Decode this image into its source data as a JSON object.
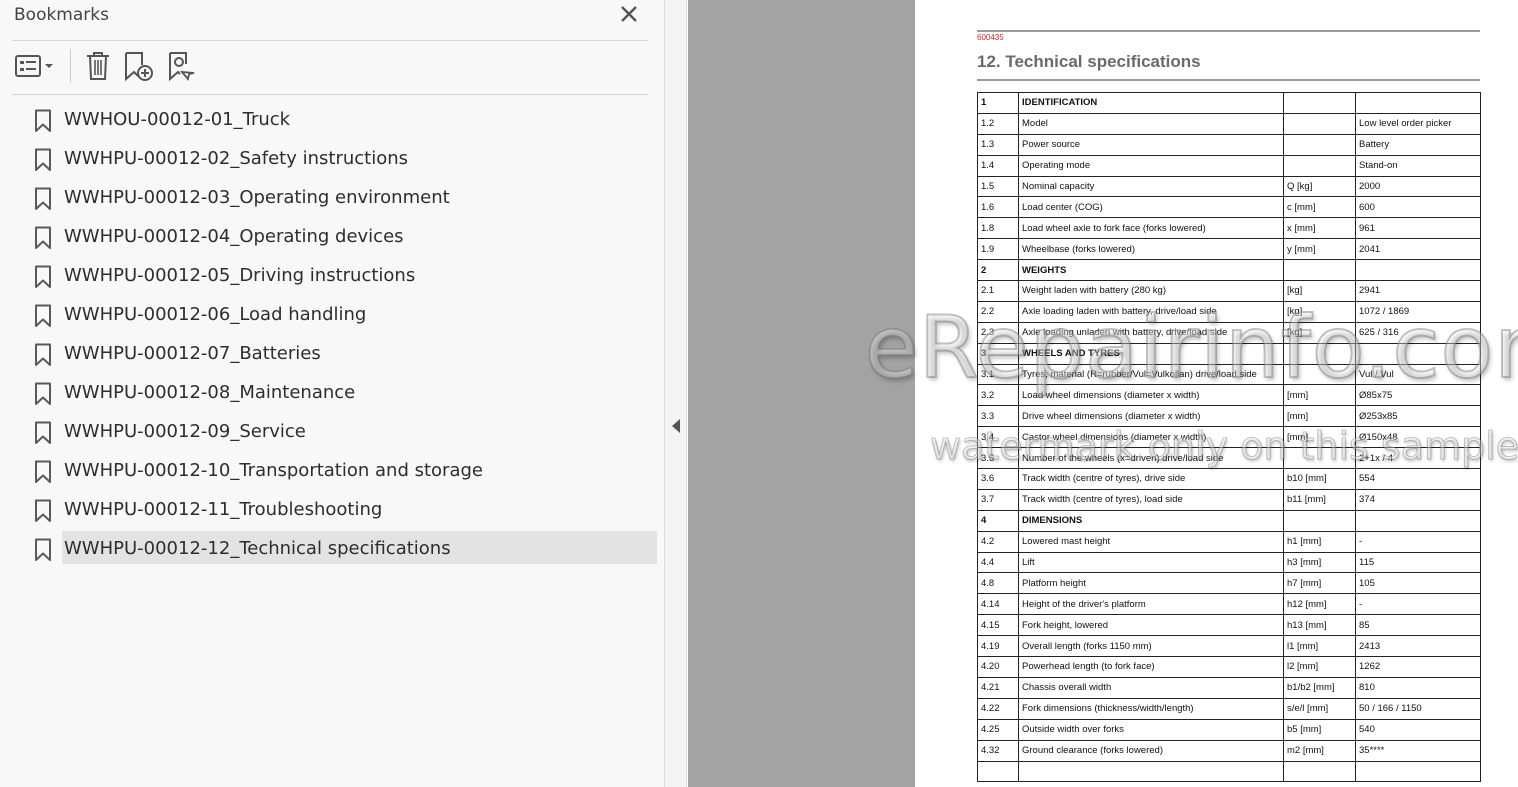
{
  "panel": {
    "title": "Bookmarks",
    "toolbar": {
      "options_icon": "list-options-icon",
      "delete_icon": "trash-icon",
      "add_icon": "add-bookmark-icon",
      "find_icon": "find-bookmark-icon"
    },
    "bookmarks": [
      {
        "label": "WWHOU-00012-01_Truck"
      },
      {
        "label": "WWHPU-00012-02_Safety instructions"
      },
      {
        "label": "WWHPU-00012-03_Operating environment"
      },
      {
        "label": "WWHPU-00012-04_Operating devices"
      },
      {
        "label": "WWHPU-00012-05_Driving instructions"
      },
      {
        "label": "WWHPU-00012-06_Load handling"
      },
      {
        "label": "WWHPU-00012-07_Batteries"
      },
      {
        "label": "WWHPU-00012-08_Maintenance"
      },
      {
        "label": "WWHPU-00012-09_Service"
      },
      {
        "label": "WWHPU-00012-10_Transportation and storage"
      },
      {
        "label": "WWHPU-00012-11_Troubleshooting"
      },
      {
        "label": "WWHPU-00012-12_Technical specifications",
        "selected": true
      }
    ]
  },
  "document": {
    "code": "600435",
    "heading": "12. Technical specifications",
    "rows": [
      {
        "no": "1",
        "desc": "IDENTIFICATION",
        "unit": "",
        "value": "",
        "section": true
      },
      {
        "no": "1.2",
        "desc": "Model",
        "unit": "",
        "value": "Low level order picker"
      },
      {
        "no": "1.3",
        "desc": "Power source",
        "unit": "",
        "value": "Battery"
      },
      {
        "no": "1.4",
        "desc": "Operating mode",
        "unit": "",
        "value": "Stand-on"
      },
      {
        "no": "1.5",
        "desc": "Nominal capacity",
        "unit": "Q [kg]",
        "value": "2000"
      },
      {
        "no": "1.6",
        "desc": "Load center (COG)",
        "unit": "c [mm]",
        "value": "600"
      },
      {
        "no": "1.8",
        "desc": "Load wheel axle to fork face (forks lowered)",
        "unit": "x [mm]",
        "value": "961"
      },
      {
        "no": "1.9",
        "desc": "Wheelbase (forks lowered)",
        "unit": "y [mm]",
        "value": "2041"
      },
      {
        "no": "2",
        "desc": "WEIGHTS",
        "unit": "",
        "value": "",
        "section": true
      },
      {
        "no": "2.1",
        "desc": "Weight laden with battery (280 kg)",
        "unit": "[kg]",
        "value": "2941"
      },
      {
        "no": "2.2",
        "desc": "Axle loading laden with battery, drive/load side",
        "unit": "[kg]",
        "value": "1072 / 1869"
      },
      {
        "no": "2.3",
        "desc": "Axle loading unladen with battery, drive/load side",
        "unit": "[kg]",
        "value": "625 / 316"
      },
      {
        "no": "3",
        "desc": "WHEELS AND TYRES",
        "unit": "",
        "value": "",
        "section": true
      },
      {
        "no": "3.1",
        "desc": "Tyres, material (R=rubber/Vul=Vulkollan) drive/load side",
        "unit": "",
        "value": "Vul / Vul"
      },
      {
        "no": "3.2",
        "desc": "Load wheel dimensions (diameter x width)",
        "unit": "[mm]",
        "value": "Ø85x75"
      },
      {
        "no": "3.3",
        "desc": "Drive wheel dimensions (diameter x width)",
        "unit": "[mm]",
        "value": "Ø253x85"
      },
      {
        "no": "3.4",
        "desc": "Castor wheel dimensions (diameter x width)",
        "unit": "[mm]",
        "value": "Ø150x48"
      },
      {
        "no": "3.5",
        "desc": "Number of the wheels (x=driven) drive/load side",
        "unit": "",
        "value": "2+1x / 4"
      },
      {
        "no": "3.6",
        "desc": "Track width (centre of tyres), drive side",
        "unit": "b10 [mm]",
        "value": "554"
      },
      {
        "no": "3.7",
        "desc": "Track width (centre of tyres), load side",
        "unit": "b11 [mm]",
        "value": "374"
      },
      {
        "no": "4",
        "desc": "DIMENSIONS",
        "unit": "",
        "value": "",
        "section": true
      },
      {
        "no": "4.2",
        "desc": "Lowered mast height",
        "unit": "h1 [mm]",
        "value": "-"
      },
      {
        "no": "4.4",
        "desc": "Lift",
        "unit": "h3 [mm]",
        "value": "115"
      },
      {
        "no": "4.8",
        "desc": "Platform height",
        "unit": "h7 [mm]",
        "value": "105"
      },
      {
        "no": "4.14",
        "desc": "Height of the driver's platform",
        "unit": "h12 [mm]",
        "value": "-"
      },
      {
        "no": "4.15",
        "desc": "Fork height, lowered",
        "unit": "h13 [mm]",
        "value": "85"
      },
      {
        "no": "4.19",
        "desc": "Overall length (forks 1150 mm)",
        "unit": "l1 [mm]",
        "value": "2413"
      },
      {
        "no": "4.20",
        "desc": "Powerhead length (to fork face)",
        "unit": "l2 [mm]",
        "value": "1262"
      },
      {
        "no": "4.21",
        "desc": "Chassis overall width",
        "unit": "b1/b2 [mm]",
        "value": "810"
      },
      {
        "no": "4.22",
        "desc": "Fork dimensions (thickness/width/length)",
        "unit": "s/e/l [mm]",
        "value": "50 / 166 / 1150"
      },
      {
        "no": "4.25",
        "desc": "Outside width over forks",
        "unit": "b5 [mm]",
        "value": "540"
      },
      {
        "no": "4.32",
        "desc": "Ground clearance (forks lowered)",
        "unit": "m2 [mm]",
        "value": "35****"
      },
      {
        "no": "",
        "desc": "",
        "unit": "",
        "value": ""
      }
    ]
  },
  "watermark": {
    "main": "eRepairinfo.com",
    "sub": "watermark only on this sample"
  }
}
